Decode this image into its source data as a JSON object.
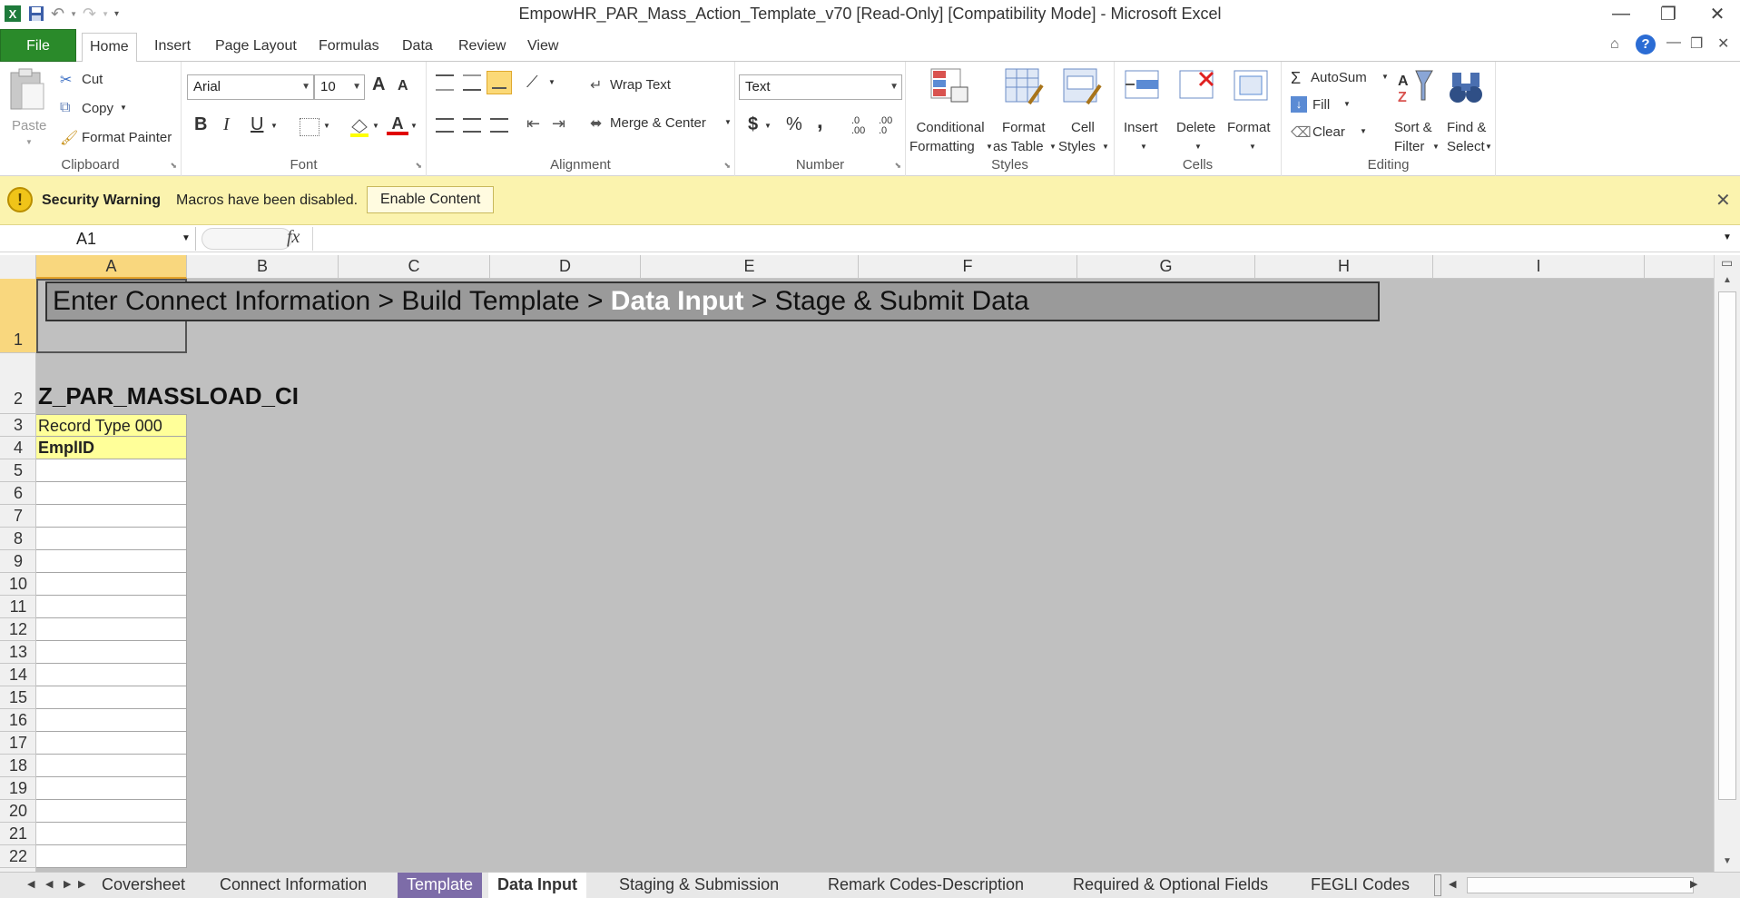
{
  "window": {
    "title": "EmpowHR_PAR_Mass_Action_Template_v70  [Read-Only]  [Compatibility Mode]  -  Microsoft Excel"
  },
  "ribbon_tabs": [
    "File",
    "Home",
    "Insert",
    "Page Layout",
    "Formulas",
    "Data",
    "Review",
    "View"
  ],
  "clipboard": {
    "paste": "Paste",
    "cut": "Cut",
    "copy": "Copy",
    "format_painter": "Format Painter",
    "label": "Clipboard"
  },
  "font": {
    "name": "Arial",
    "size": "10",
    "bold": "B",
    "italic": "I",
    "underline": "U",
    "label": "Font",
    "grow": "A",
    "shrink": "A"
  },
  "alignment": {
    "wrap_text": "Wrap Text",
    "merge_center": "Merge & Center",
    "label": "Alignment"
  },
  "number": {
    "format": "Text",
    "currency": "$",
    "percent": "%",
    "comma": ",",
    "inc_decimal": ".0 .00",
    "dec_decimal": ".00 .0",
    "label": "Number"
  },
  "styles": {
    "cond_fmt_1": "Conditional",
    "cond_fmt_2": "Formatting",
    "fmt_table_1": "Format",
    "fmt_table_2": "as Table",
    "cell_styles_1": "Cell",
    "cell_styles_2": "Styles",
    "label": "Styles"
  },
  "cells": {
    "insert": "Insert",
    "delete": "Delete",
    "format": "Format",
    "label": "Cells"
  },
  "editing": {
    "autosum": "AutoSum",
    "fill": "Fill",
    "clear": "Clear",
    "sort_1": "Sort &",
    "sort_2": "Filter",
    "find_1": "Find &",
    "find_2": "Select",
    "label": "Editing"
  },
  "security": {
    "title": "Security Warning",
    "message": "Macros have been disabled.",
    "button": "Enable Content"
  },
  "formula_bar": {
    "name_box": "A1",
    "fx": "fx",
    "formula": ""
  },
  "columns": [
    "A",
    "B",
    "C",
    "D",
    "E",
    "F",
    "G",
    "H",
    "I"
  ],
  "rows": [
    "1",
    "2",
    "3",
    "4",
    "5",
    "6",
    "7",
    "8",
    "9",
    "10",
    "11",
    "12",
    "13",
    "14",
    "15",
    "16",
    "17",
    "18",
    "19",
    "20",
    "21",
    "22"
  ],
  "sheet": {
    "breadcrumb_pre": "Enter Connect Information > Build Template > ",
    "breadcrumb_current": "Data Input",
    "breadcrumb_post": " > Stage & Submit Data",
    "title": "Z_PAR_MASSLOAD_CI",
    "record_type": "Record Type 000",
    "emplid": "EmplID"
  },
  "sheet_tabs": [
    "Coversheet",
    "Connect Information",
    "Template",
    "Data Input",
    "Staging & Submission",
    "Remark Codes-Description",
    "Required & Optional Fields",
    "FEGLI Codes"
  ],
  "colors": {
    "file_tab": "#2a8a2a",
    "security_bar": "#fbf3ae",
    "grid_bg": "#c0c0c0",
    "breadcrumb_bg": "#9a9a9a",
    "header_cell": "#ffff99",
    "template_tab": "#7d6ca8"
  }
}
